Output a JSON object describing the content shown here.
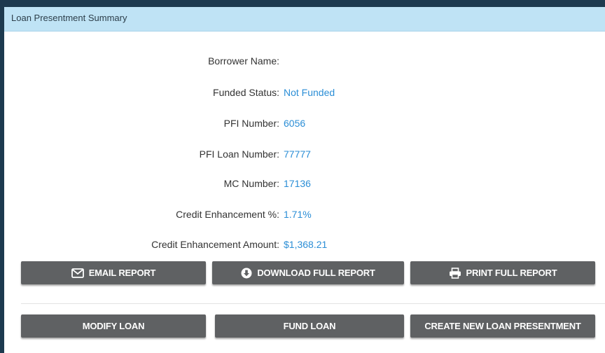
{
  "panel": {
    "title": "Loan Presentment Summary"
  },
  "fields": [
    {
      "label": "Borrower Name:",
      "value": ""
    },
    {
      "label": "Funded Status:",
      "value": "Not Funded"
    },
    {
      "label": "PFI Number:",
      "value": "6056"
    },
    {
      "label": "PFI Loan Number:",
      "value": "77777"
    },
    {
      "label": "MC Number:",
      "value": "17136"
    },
    {
      "label": "Credit Enhancement %:",
      "value": "1.71%"
    },
    {
      "label": "Credit Enhancement Amount:",
      "value": "$1,368.21"
    }
  ],
  "report_actions": {
    "email": {
      "label": "Email Report",
      "icon": "envelope-icon"
    },
    "download": {
      "label": "Download Full Report",
      "icon": "download-circle-icon"
    },
    "print": {
      "label": "Print Full Report",
      "icon": "printer-icon"
    }
  },
  "loan_actions": {
    "modify": {
      "label": "Modify Loan"
    },
    "fund": {
      "label": "Fund Loan"
    },
    "create": {
      "label": "Create New Loan Presentment"
    }
  },
  "colors": {
    "header_bg": "#bfe3f5",
    "button_bg": "#5f6163",
    "value_text": "#2b8ed6",
    "frame_border": "#1d3a4f"
  }
}
